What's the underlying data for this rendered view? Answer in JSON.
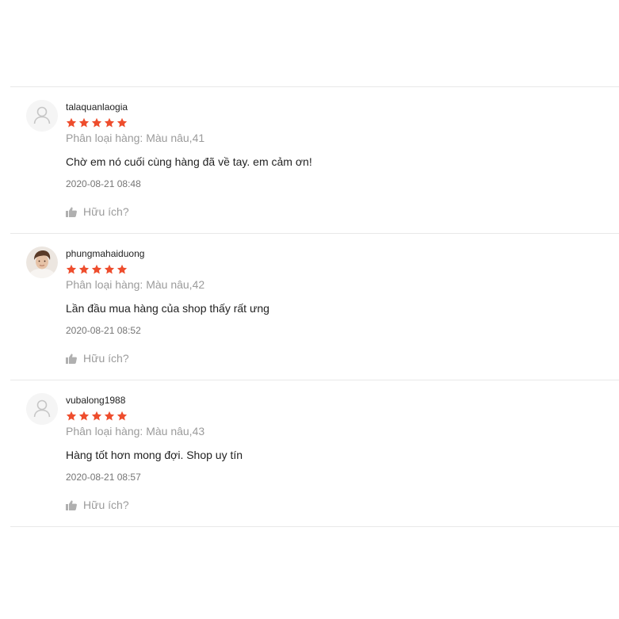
{
  "colors": {
    "star": "#ee4d2d",
    "divider": "#e8e8e8",
    "muted_text": "#9b9b9b",
    "timestamp_text": "#757575",
    "primary_text": "#222222"
  },
  "icons": {
    "avatar_placeholder": "user-silhouette-icon",
    "star": "star-icon",
    "helpful": "thumbs-up-icon"
  },
  "reviews": [
    {
      "username": "talaquanlaogia",
      "avatar": "placeholder",
      "rating": 5,
      "variation": "Phân loại hàng: Màu nâu,41",
      "comment": "Chờ em nó cuối cùng hàng đã về tay. em cảm ơn!",
      "time": "2020-08-21 08:48",
      "helpful_label": "Hữu ích?"
    },
    {
      "username": "phungmahaiduong",
      "avatar": "photo",
      "rating": 5,
      "variation": "Phân loại hàng: Màu nâu,42",
      "comment": "Lần đầu mua hàng của shop thấy rất ưng",
      "time": "2020-08-21 08:52",
      "helpful_label": "Hữu ích?"
    },
    {
      "username": "vubalong1988",
      "avatar": "placeholder",
      "rating": 5,
      "variation": "Phân loại hàng: Màu nâu,43",
      "comment": "Hàng tốt hơn mong đợi. Shop uy tín",
      "time": "2020-08-21 08:57",
      "helpful_label": "Hữu ích?"
    }
  ]
}
